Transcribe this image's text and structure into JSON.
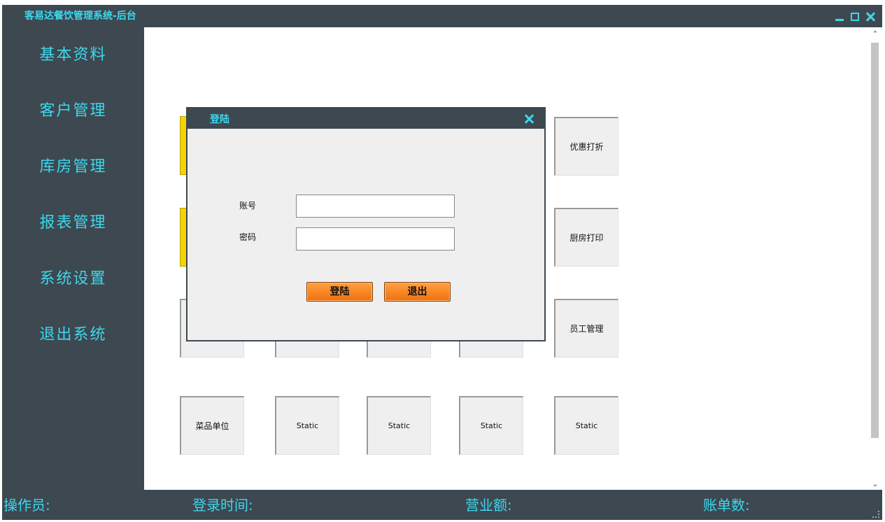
{
  "app": {
    "title": "客易达餐饮管理系统-后台"
  },
  "sidebar": {
    "items": [
      {
        "label": "基本资料"
      },
      {
        "label": "客户管理"
      },
      {
        "label": "库房管理"
      },
      {
        "label": "报表管理"
      },
      {
        "label": "系统设置"
      },
      {
        "label": "退出系统"
      }
    ]
  },
  "tiles": {
    "row1_right": "优惠打折",
    "row2_right": "厨房打印",
    "row3_right": "员工管理",
    "row4": [
      "菜品单位",
      "Static",
      "Static",
      "Static",
      "Static"
    ]
  },
  "dialog": {
    "title": "登陆",
    "account_label": "账号",
    "password_label": "密码",
    "account_value": "",
    "password_value": "",
    "login_button": "登陆",
    "exit_button": "退出"
  },
  "statusbar": {
    "operator_label": "操作员:",
    "login_time_label": "登录时间:",
    "revenue_label": "营业额:",
    "bill_count_label": "账单数:"
  },
  "colors": {
    "frame": "#3d4850",
    "accent_text": "#3cd8ee",
    "button_orange": "#f07010",
    "tile_bg": "#efefef"
  }
}
